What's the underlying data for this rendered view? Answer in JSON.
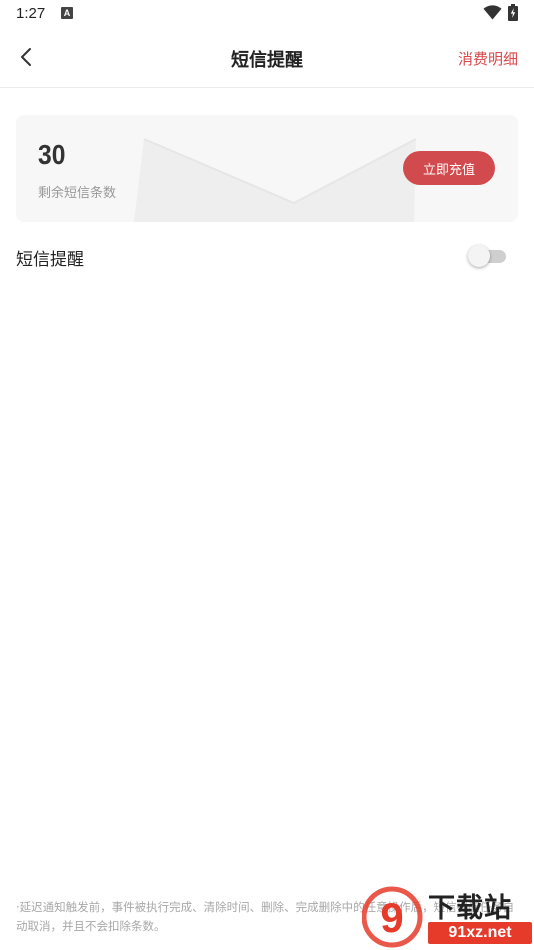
{
  "status_bar": {
    "time": "1:27",
    "notification_icon": "A",
    "icons": [
      "wifi-icon",
      "battery-charging-icon"
    ]
  },
  "nav": {
    "back_icon": "chevron-left-icon",
    "title": "短信提醒",
    "right_link": "消费明细"
  },
  "balance_card": {
    "count": "30",
    "label": "剩余短信条数",
    "recharge_label": "立即充值"
  },
  "sms_reminder": {
    "label": "短信提醒",
    "enabled": false
  },
  "footer": {
    "note": "·延迟通知触发前，事件被执行完成、清除时间、删除、完成删除中的任意操作后，短信提醒任务自动取消，并且不会扣除条数。"
  },
  "watermark": {
    "logo_text": "9",
    "brand": "下载站",
    "site": "91xz.net"
  },
  "colors": {
    "accent": "#d9484b",
    "button": "#d14b4e",
    "card_bg": "#f7f7f7"
  }
}
